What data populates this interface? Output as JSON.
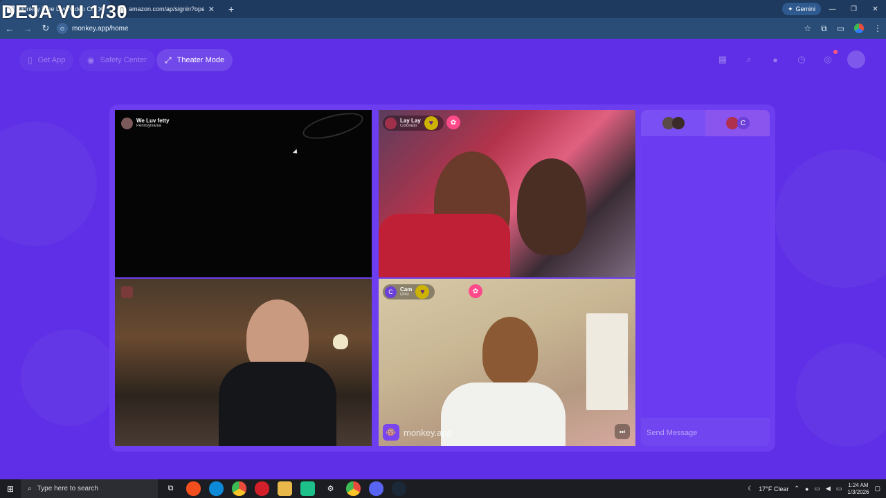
{
  "overlay": {
    "title": "DEJA VU 1/30"
  },
  "browser": {
    "tabs": [
      {
        "title": "Monkey Free Live Video Chat | BULLY",
        "active": true
      },
      {
        "title": "amazon.com/ap/signin?openid",
        "active": false
      }
    ],
    "new_tab": "+",
    "gemini_label": "Gemini",
    "url": "monkey.app/home"
  },
  "app": {
    "nav": {
      "get_app": "Get App",
      "safety_center": "Safety Center",
      "theater_mode": "Theater Mode"
    },
    "tiles": [
      {
        "name": "We Luv fetty",
        "location": "Pennsylvania"
      },
      {
        "name": "Lay Lay",
        "location": "Colorado"
      },
      {
        "name": "",
        "location": ""
      },
      {
        "name": "Cam",
        "location": "Ohio"
      }
    ],
    "watermark": "monkey.app",
    "chat": {
      "tab_initial": "C",
      "placeholder": "Send Message"
    }
  },
  "taskbar": {
    "search_placeholder": "Type here to search",
    "weather": "17°F  Clear",
    "time": "1:24 AM",
    "date": "1/3/2026"
  },
  "colors": {
    "page_bg": "#5e2fe6",
    "stage_bg": "#6c3ef0",
    "browser_tab_bar": "#1f3a5f",
    "heart_button": "#cdb300",
    "gift_button": "#ff4a8a"
  }
}
